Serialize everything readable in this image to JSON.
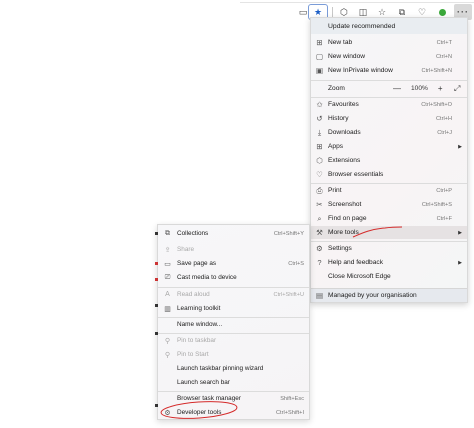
{
  "toolbar": {
    "icons": [
      "reading-view-icon",
      "favorites-star-icon",
      "extensions-icon",
      "split-screen-icon",
      "favorites-icon",
      "collections-icon",
      "browser-essentials-icon",
      "profile-icon",
      "settings-and-more-icon"
    ],
    "more_label": "···"
  },
  "main_menu": {
    "update": "Update recommended",
    "items": [
      {
        "label": "New tab",
        "shortcut": "Ctrl+T"
      },
      {
        "label": "New window",
        "shortcut": "Ctrl+N"
      },
      {
        "label": "New InPrivate window",
        "shortcut": "Ctrl+Shift+N"
      }
    ],
    "zoom": {
      "label": "Zoom",
      "minus": "—",
      "value": "100%",
      "plus": "+"
    },
    "group2": [
      {
        "label": "Favourites",
        "shortcut": "Ctrl+Shift+O"
      },
      {
        "label": "History",
        "shortcut": "Ctrl+H"
      },
      {
        "label": "Downloads",
        "shortcut": "Ctrl+J"
      },
      {
        "label": "Apps",
        "shortcut": ""
      },
      {
        "label": "Extensions",
        "shortcut": ""
      },
      {
        "label": "Browser essentials",
        "shortcut": ""
      }
    ],
    "group3": [
      {
        "label": "Print",
        "shortcut": "Ctrl+P"
      },
      {
        "label": "Screenshot",
        "shortcut": "Ctrl+Shift+S"
      },
      {
        "label": "Find on page",
        "shortcut": "Ctrl+F"
      },
      {
        "label": "More tools",
        "shortcut": ""
      }
    ],
    "group4": [
      {
        "label": "Settings"
      },
      {
        "label": "Help and feedback"
      },
      {
        "label": "Close Microsoft Edge"
      }
    ],
    "managed": "Managed by your organisation"
  },
  "sub_menu": {
    "items": [
      {
        "label": "Collections",
        "shortcut": "Ctrl+Shift+Y"
      },
      {
        "label": "Share",
        "shortcut": ""
      },
      {
        "label": "Save page as",
        "shortcut": "Ctrl+S"
      },
      {
        "label": "Cast media to device",
        "shortcut": ""
      },
      {
        "label": "Read aloud",
        "shortcut": "Ctrl+Shift+U"
      },
      {
        "label": "Learning toolkit",
        "shortcut": ""
      },
      {
        "label": "Name window...",
        "shortcut": ""
      },
      {
        "label": "Pin to taskbar",
        "shortcut": ""
      },
      {
        "label": "Pin to Start",
        "shortcut": ""
      },
      {
        "label": "Launch taskbar pinning wizard",
        "shortcut": ""
      },
      {
        "label": "Launch search bar",
        "shortcut": ""
      },
      {
        "label": "Browser task manager",
        "shortcut": "Shift+Esc"
      },
      {
        "label": "Developer tools",
        "shortcut": "Ctrl+Shift+I"
      }
    ]
  },
  "colors": {
    "annotation": "#d42a2a",
    "star": "#1c5fc7",
    "update_bg": "#e9edf1"
  }
}
